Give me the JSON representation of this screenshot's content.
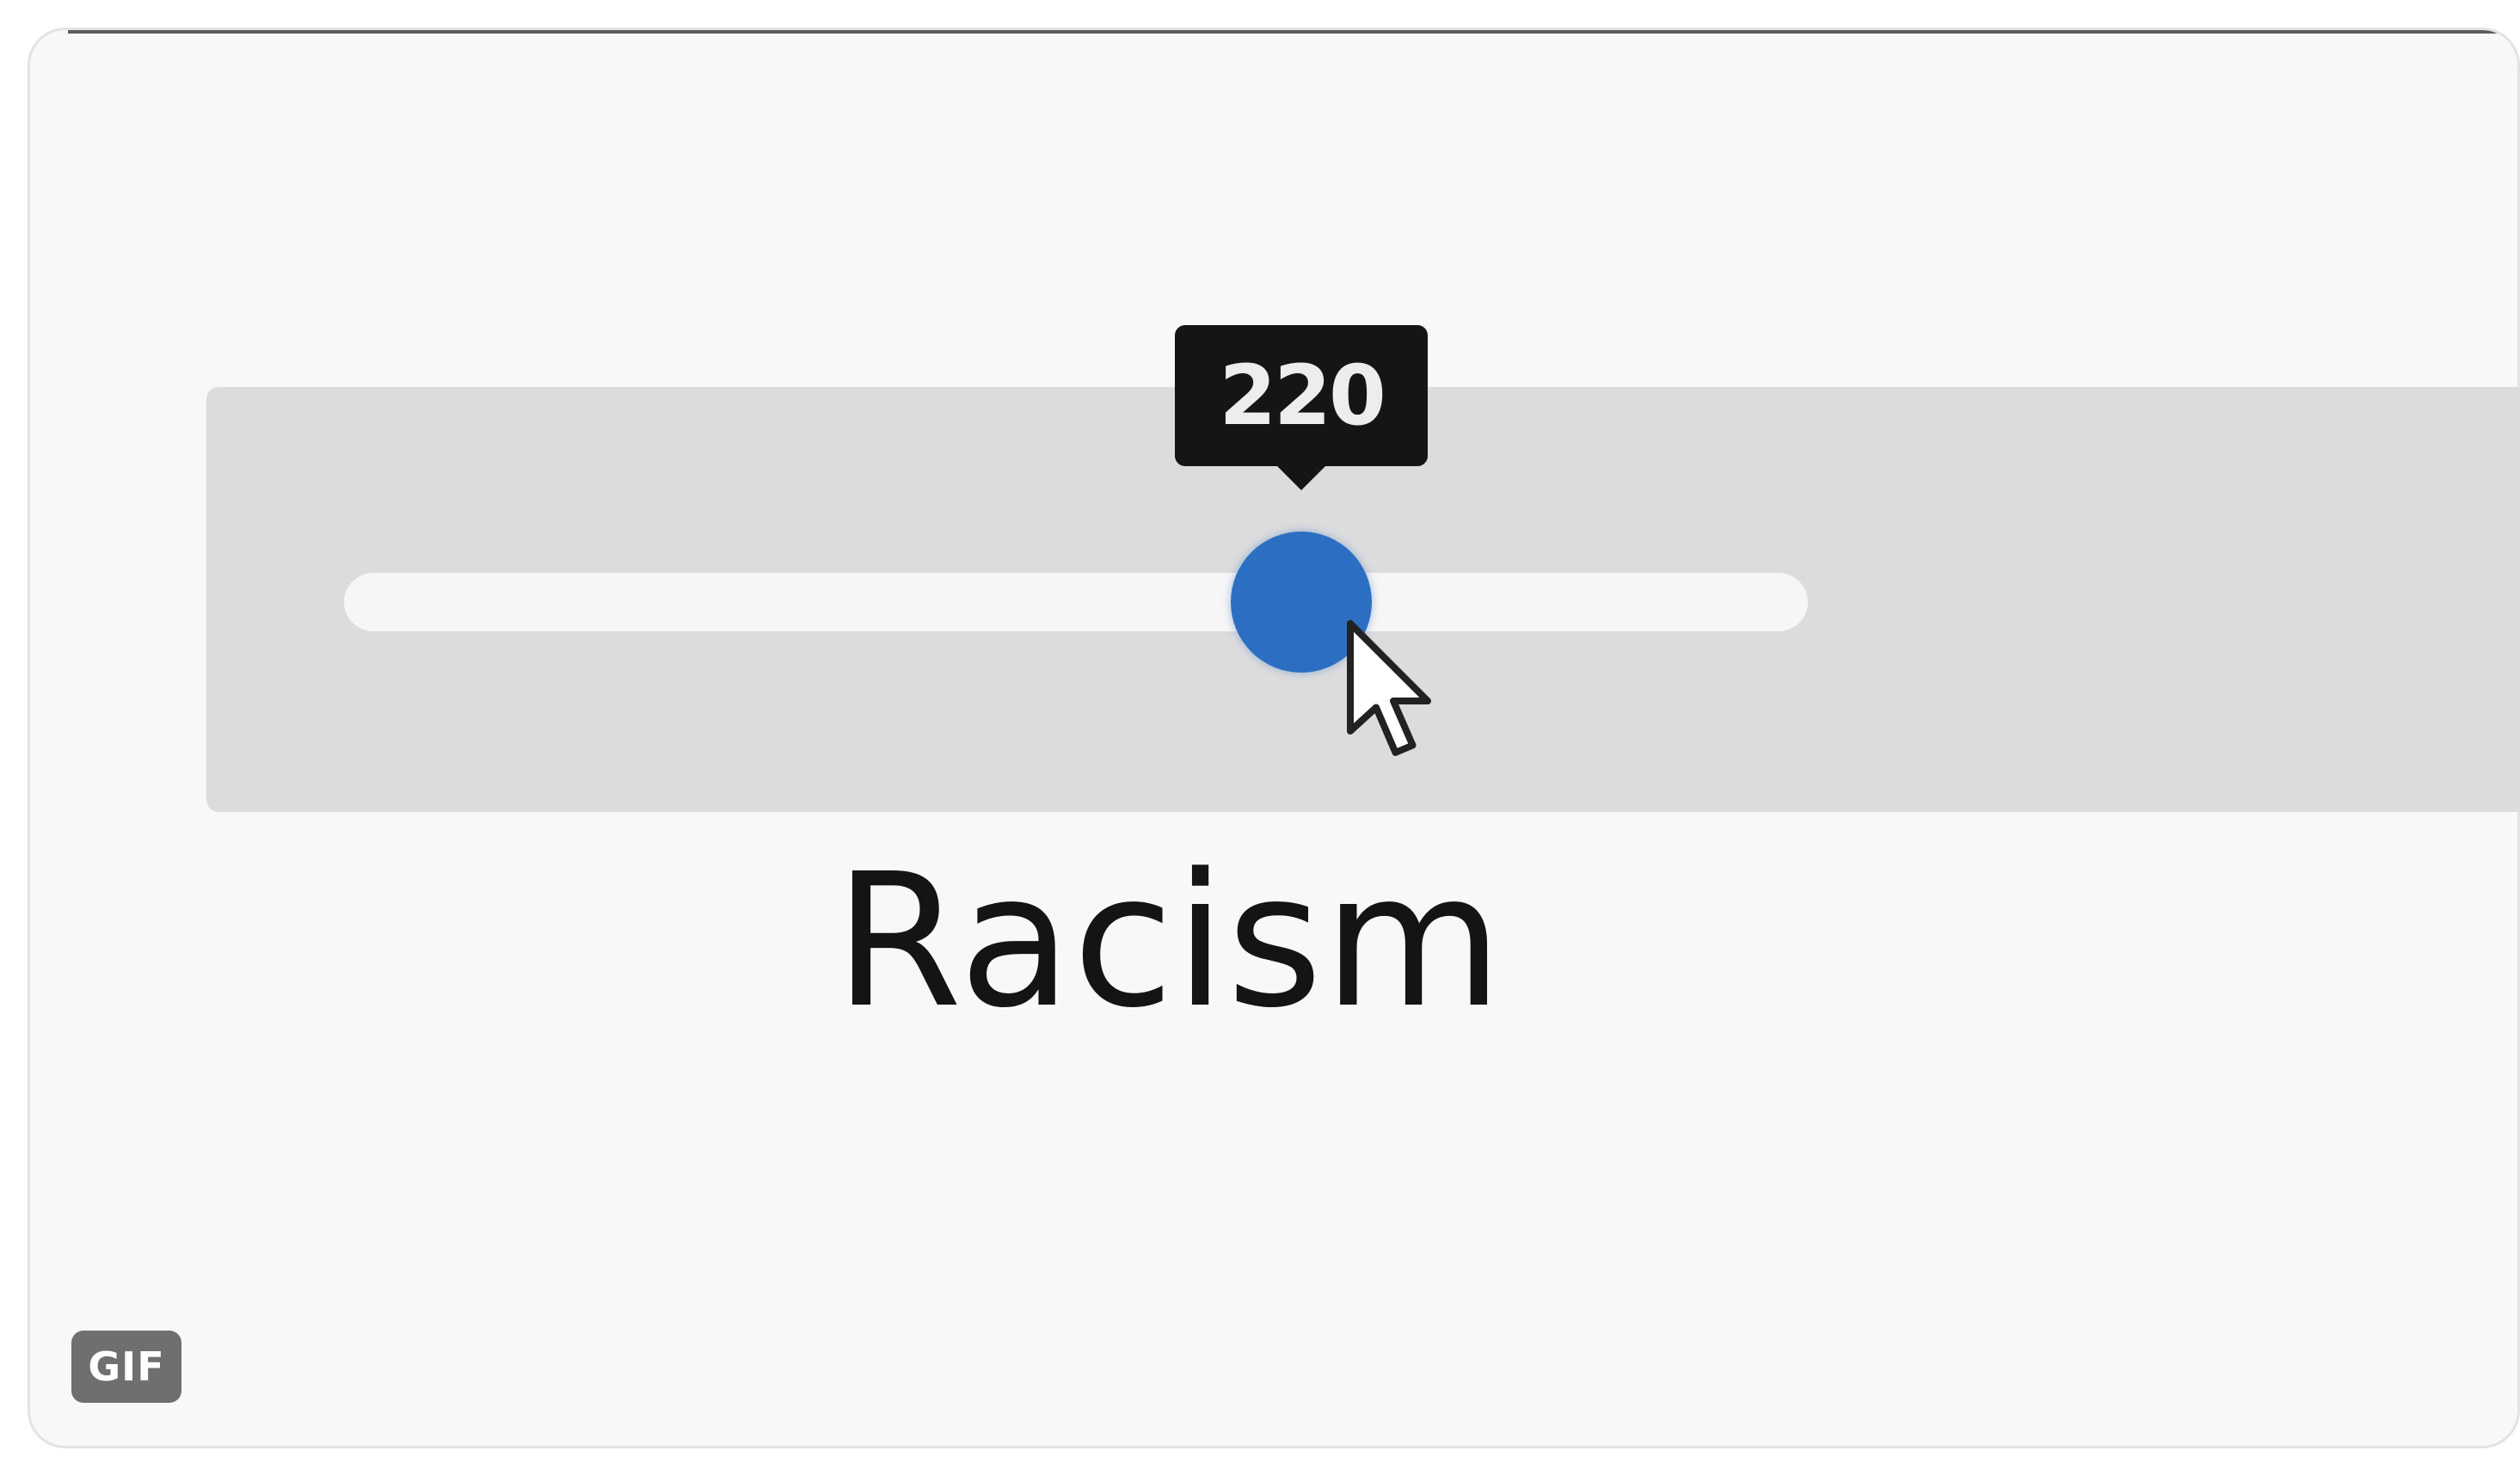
{
  "slider": {
    "label": "Racism",
    "value": 220,
    "value_text": "220",
    "fill_fraction": 0.66,
    "thumb_color": "#2c6fc2",
    "track_color": "#f6f6f7",
    "panel_color": "#dcdcdd"
  },
  "badge": {
    "text": "GIF"
  },
  "cursor": {
    "icon": "arrow-pointer-icon"
  }
}
